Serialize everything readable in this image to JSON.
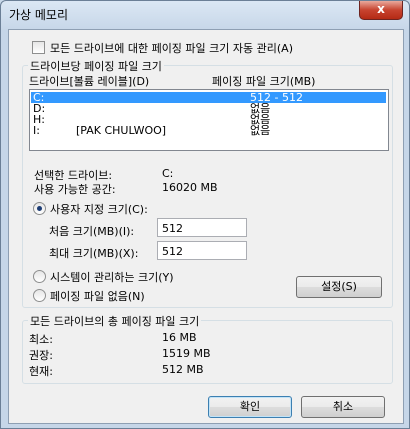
{
  "window": {
    "title": "가상 메모리",
    "close_glyph": "x"
  },
  "auto_manage": {
    "label": "모든 드라이브에 대한 페이징 파일 크기 자동 관리(A)",
    "checked": false
  },
  "drive_group": {
    "title": "드라이브당 페이징 파일 크기",
    "col_drive": "드라이브[볼륨 레이블](D)",
    "col_size": "페이징 파일 크기(MB)",
    "rows": [
      {
        "drive": "C:",
        "label": "",
        "size": "512 - 512",
        "selected": true
      },
      {
        "drive": "D:",
        "label": "",
        "size": "없음",
        "selected": false
      },
      {
        "drive": "H:",
        "label": "",
        "size": "없음",
        "selected": false
      },
      {
        "drive": "I:",
        "label": "[PAK CHULWOO]",
        "size": "없음",
        "selected": false
      }
    ],
    "selected_drive_label": "선택한 드라이브:",
    "selected_drive_value": "C:",
    "free_space_label": "사용 가능한 공간:",
    "free_space_value": "16020 MB",
    "custom_size_label": "사용자 지정 크기(C):",
    "initial_label": "처음 크기(MB)(I):",
    "initial_value": "512",
    "max_label": "최대 크기(MB)(X):",
    "max_value": "512",
    "system_managed_label": "시스템이 관리하는 크기(Y)",
    "no_paging_label": "페이징 파일 없음(N)",
    "set_button": "설정(S)",
    "selected_option": "custom"
  },
  "total_group": {
    "title": "모든 드라이브의 총 페이징 파일 크기",
    "min_label": "최소:",
    "min_value": "16 MB",
    "recommended_label": "권장:",
    "recommended_value": "1519 MB",
    "current_label": "현재:",
    "current_value": "512 MB"
  },
  "buttons": {
    "ok": "확인",
    "cancel": "취소"
  }
}
